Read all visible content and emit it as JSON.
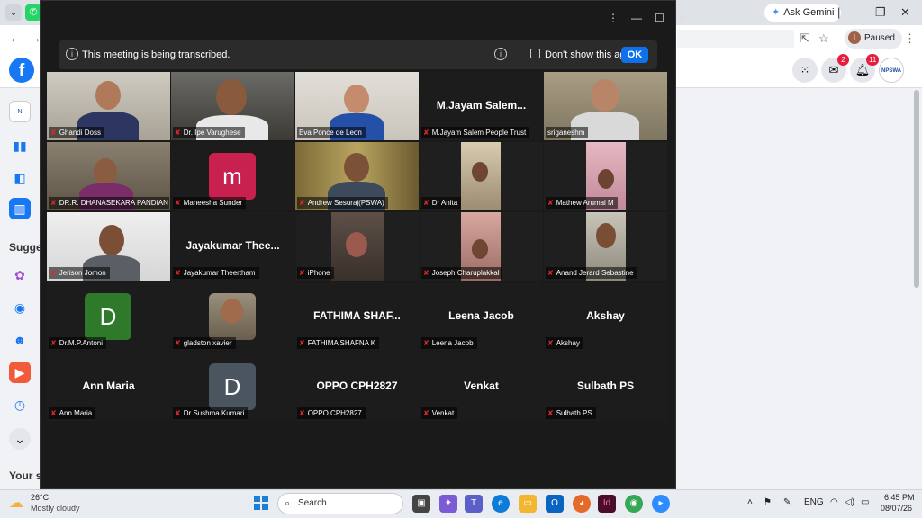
{
  "browser": {
    "gemini_label": "Ask Gemini",
    "profile_status": "Paused",
    "profile_initial": "I"
  },
  "facebook": {
    "logo": "f",
    "suggested_label": "Sugge",
    "your_shortcuts_label": "Your s",
    "messenger_badge": "2",
    "notifications_badge": "11",
    "page_badge": "NPSWA"
  },
  "meeting": {
    "banner_message": "This meeting is being transcribed.",
    "dont_show_label": "Don't show this again",
    "ok_label": "OK",
    "participants": [
      {
        "name": "Ghandi Doss"
      },
      {
        "name": "Dr. Ipe Varughese"
      },
      {
        "name": "Eva Ponce de Leon"
      },
      {
        "name": "M.Jayam Salem People Trust",
        "display": "M.Jayam  Salem..."
      },
      {
        "name": "sriganeshm"
      },
      {
        "name": "DR.R. DHANASEKARA PANDIAN"
      },
      {
        "name": "Maneesha Sunder",
        "initial": "m"
      },
      {
        "name": "Andrew Sesuraj(PSWA)"
      },
      {
        "name": "Dr Anita"
      },
      {
        "name": "Mathew Arumai M"
      },
      {
        "name": "Jerison Jomon"
      },
      {
        "name": "Jayakumar Theertham",
        "display": "Jayakumar  Thee..."
      },
      {
        "name": "iPhone"
      },
      {
        "name": "Joseph Charuplakkal"
      },
      {
        "name": "Anand Jerard Sebastine"
      },
      {
        "name": "Dr.M.P.Antoni",
        "initial": "D"
      },
      {
        "name": "gladston xavier"
      },
      {
        "name": "FATHIMA SHAFNA K",
        "display": "FATHIMA  SHAF..."
      },
      {
        "name": "Leena Jacob",
        "display": "Leena Jacob"
      },
      {
        "name": "Akshay",
        "display": "Akshay"
      },
      {
        "name": "Ann Maria",
        "display": "Ann Maria"
      },
      {
        "name": "Dr Sushma Kumari",
        "initial": "D"
      },
      {
        "name": "OPPO CPH2827",
        "display": "OPPO CPH2827"
      },
      {
        "name": "Venkat",
        "display": "Venkat"
      },
      {
        "name": "Sulbath PS",
        "display": "Sulbath PS"
      }
    ]
  },
  "taskbar": {
    "temperature": "26°C",
    "weather": "Mostly cloudy",
    "search_label": "Search",
    "language": "ENG",
    "time": "6:45 PM",
    "date": "08/07/26"
  },
  "colors": {
    "active_speaker": "#23d959",
    "ok_button": "#0e71eb",
    "muted_mic": "#e02828"
  }
}
